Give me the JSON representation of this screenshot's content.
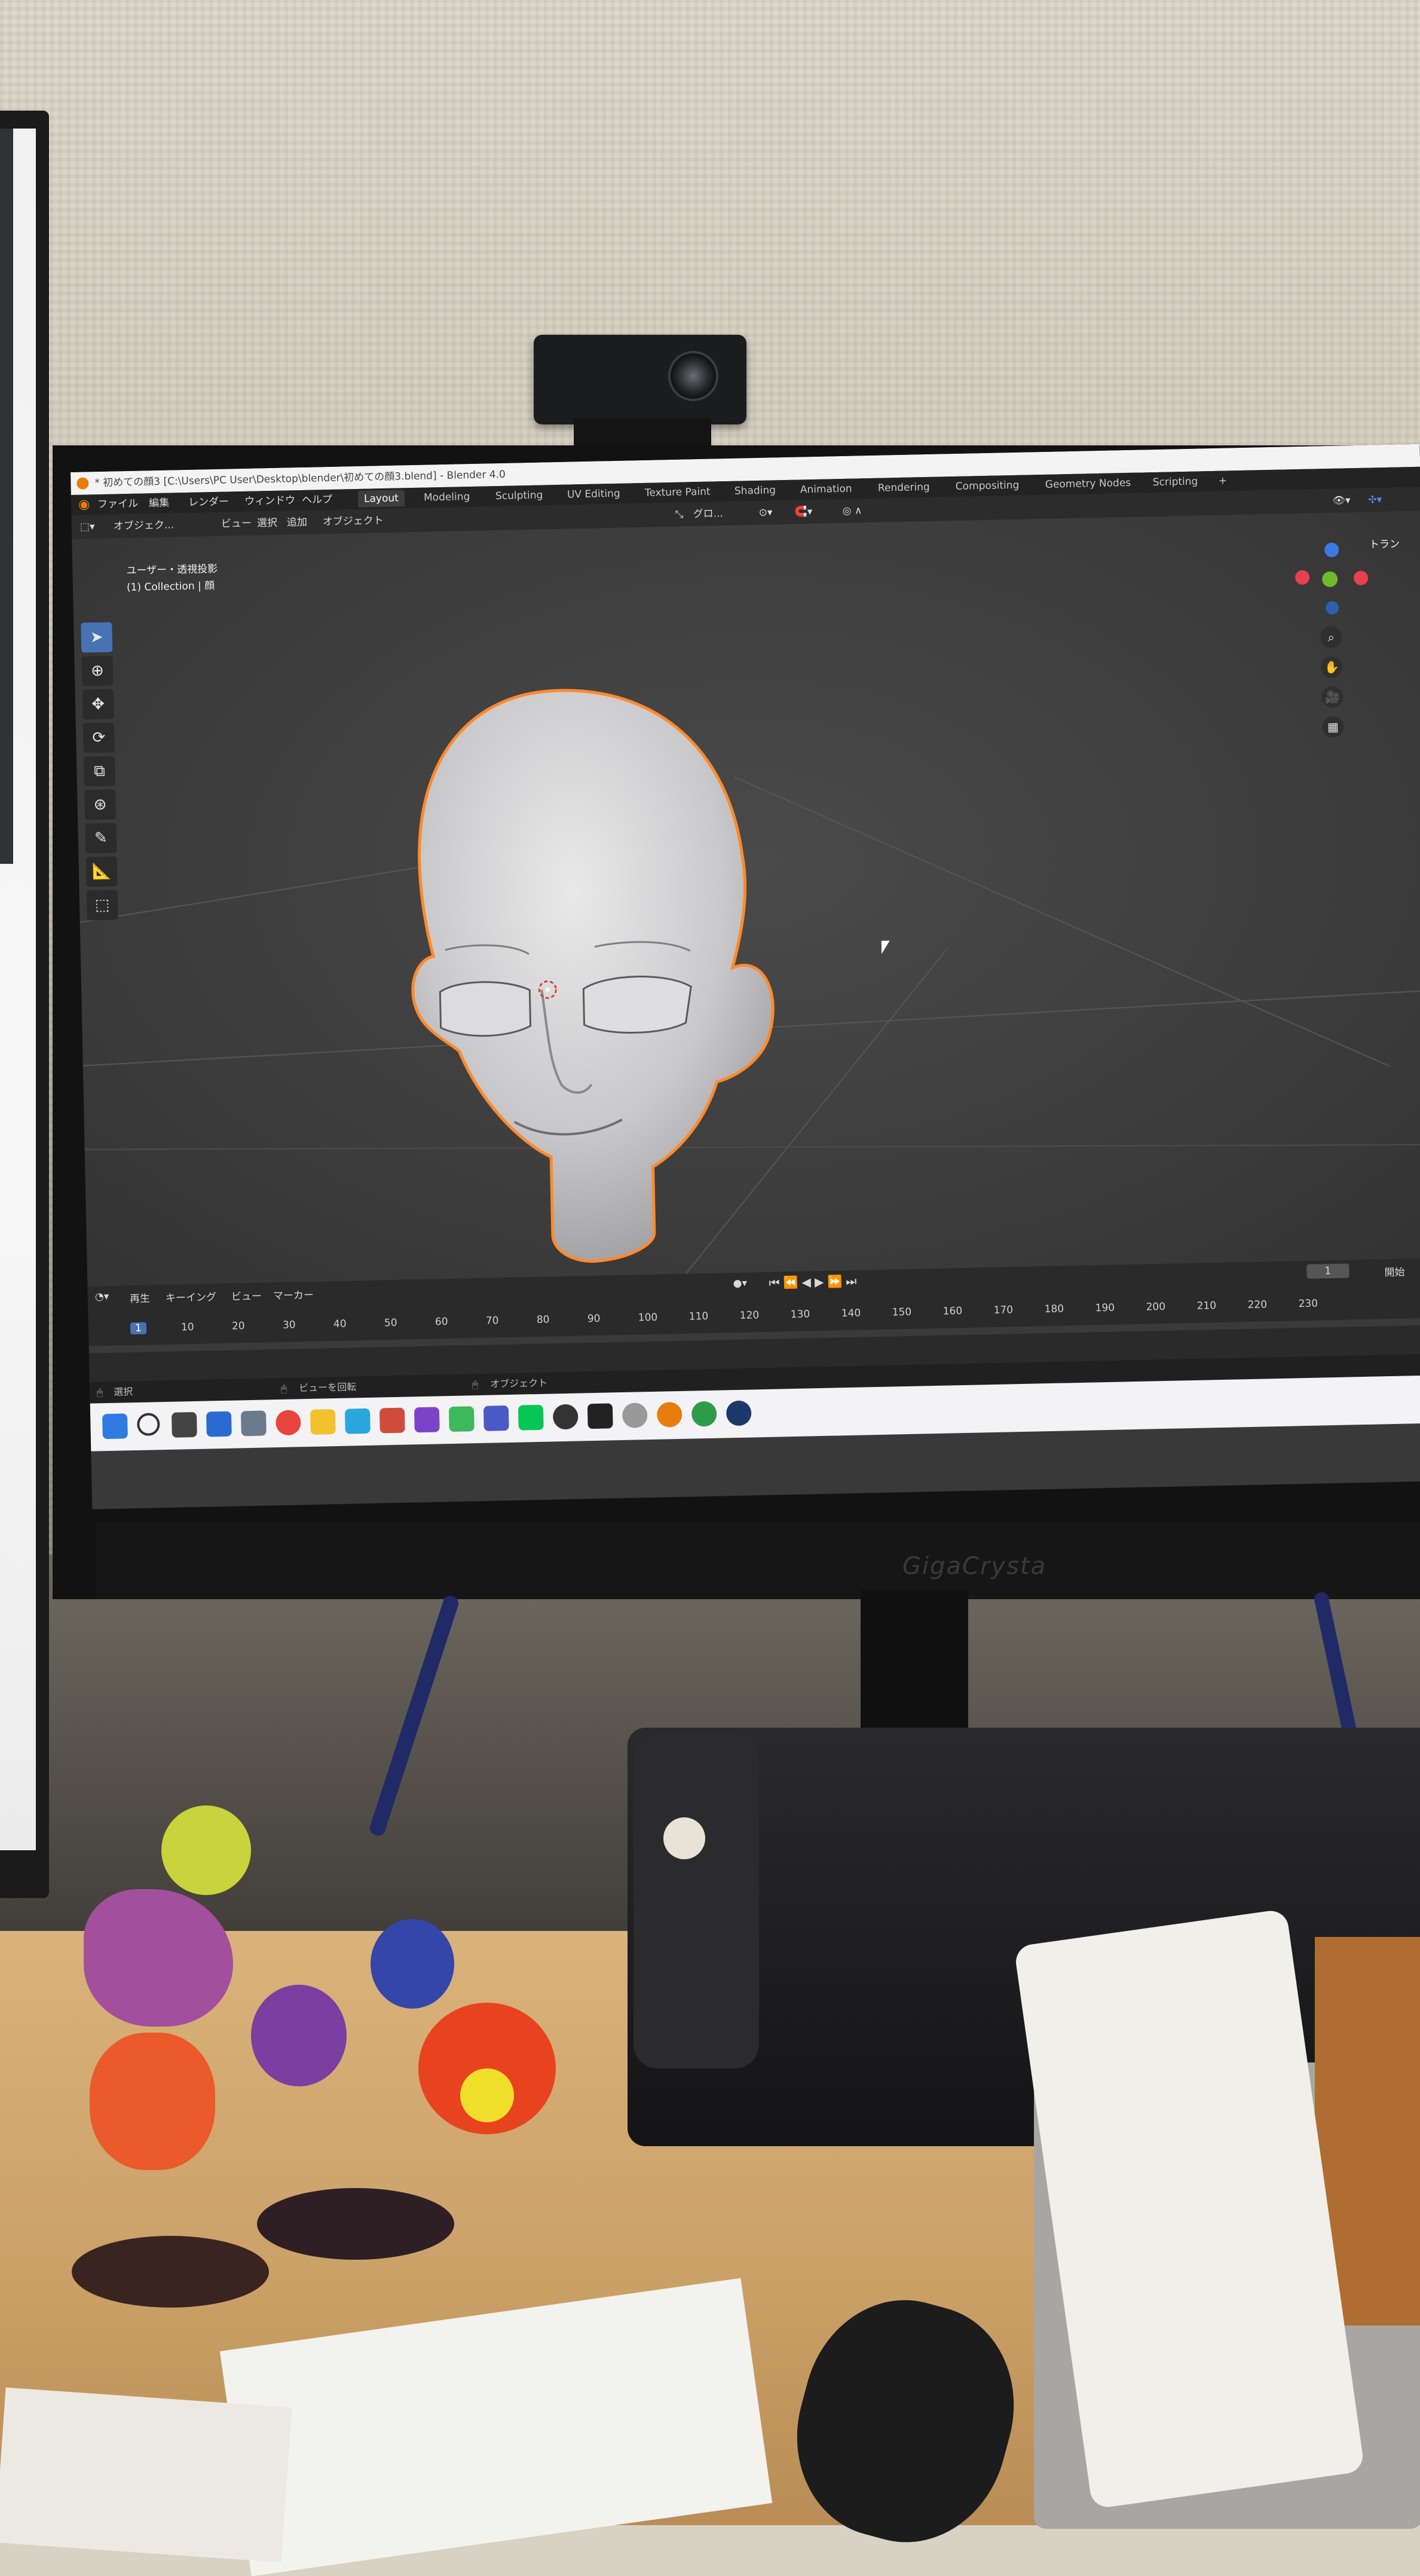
{
  "blender": {
    "title": "* 初めての顔3 [C:\\Users\\PC User\\Desktop\\blender\\初めての顔3.blend] - Blender 4.0",
    "menu": [
      "ファイル",
      "編集",
      "レンダー",
      "ウィンドウ",
      "ヘルプ"
    ],
    "workspaces": [
      "Layout",
      "Modeling",
      "Sculpting",
      "UV Editing",
      "Texture Paint",
      "Shading",
      "Animation",
      "Rendering",
      "Compositing",
      "Geometry Nodes",
      "Scripting",
      "+"
    ],
    "active_workspace": "Layout",
    "header": {
      "mode": "オブジェク...",
      "menus": [
        "ビュー",
        "選択",
        "追加",
        "オブジェクト"
      ],
      "orientation": "グロ...",
      "right_panel_label": "トラン"
    },
    "viewport": {
      "view_label": "ユーザー・透視投影",
      "collection_label": "(1) Collection | 顔"
    },
    "gizmo_axes": [
      "X",
      "Y",
      "Z"
    ],
    "timeline": {
      "menus": [
        "再生",
        "キーイング",
        "ビュー",
        "マーカー"
      ],
      "current_frame": "1",
      "start_label": "開始",
      "ticks": [
        "1",
        "10",
        "20",
        "30",
        "40",
        "50",
        "60",
        "70",
        "80",
        "90",
        "100",
        "110",
        "120",
        "130",
        "140",
        "150",
        "160",
        "170",
        "180",
        "190",
        "200",
        "210",
        "220",
        "230"
      ]
    },
    "status": [
      "選択",
      "ビューを回転",
      "オブジェクト"
    ]
  },
  "monitor_brand": "GigaCrysta",
  "colors": {
    "blender_orange": "#e87d0d",
    "active_blue": "#4772b3",
    "axis_x": "#e8404f",
    "axis_y": "#6dbb2b",
    "axis_z": "#3a7be0",
    "selection_outline": "#ff8a2b"
  }
}
